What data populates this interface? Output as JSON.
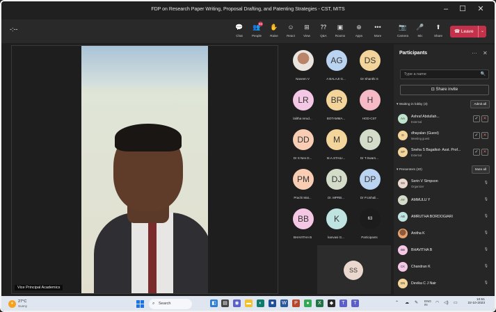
{
  "window": {
    "title": "FDP on Research Paper Writing, Proposal Drafting, and Patenting Strategies - CST, MITS",
    "minimize": "–",
    "maximize": "☐",
    "close": "✕"
  },
  "toolbar": {
    "timer": "-:--",
    "buttons": [
      {
        "label": "Chat",
        "icon": "chat-icon",
        "glyph": "💬"
      },
      {
        "label": "People",
        "icon": "people-icon",
        "glyph": "👥",
        "badge": "83"
      },
      {
        "label": "Raise",
        "icon": "raise-hand-icon",
        "glyph": "✋"
      },
      {
        "label": "React",
        "icon": "react-icon",
        "glyph": "☺"
      },
      {
        "label": "View",
        "icon": "view-icon",
        "glyph": "⊞"
      },
      {
        "label": "Q&A",
        "icon": "qa-icon",
        "glyph": "⁇"
      },
      {
        "label": "Rooms",
        "icon": "rooms-icon",
        "glyph": "▣"
      },
      {
        "label": "Apps",
        "icon": "apps-icon",
        "glyph": "⊕"
      },
      {
        "label": "More",
        "icon": "more-icon",
        "glyph": "•••"
      },
      {
        "label": "Camera",
        "icon": "camera-off-icon",
        "glyph": "📷"
      },
      {
        "label": "Mic",
        "icon": "mic-off-icon",
        "glyph": "🎤"
      },
      {
        "label": "Share",
        "icon": "share-icon",
        "glyph": "⬆"
      }
    ],
    "leave_label": "Leave",
    "leave_chevron": "⌄"
  },
  "main_video": {
    "caption": "Vice Principal Academics"
  },
  "tiles": [
    {
      "name": "Naveen V",
      "initials": "",
      "color": "#e8e0d8",
      "photo": true
    },
    {
      "name": "A BALAJI G...",
      "initials": "AG",
      "color": "#b9d3f0"
    },
    {
      "name": "Dr Shanthi S",
      "initials": "DS",
      "color": "#f3d49a"
    },
    {
      "name": "lalitha rerud...",
      "initials": "LR",
      "color": "#f4c8e4"
    },
    {
      "name": "BOTAMMA...",
      "initials": "BR",
      "color": "#f3d49a"
    },
    {
      "name": "HOD-CST",
      "initials": "H",
      "color": "#f6b9c6"
    },
    {
      "name": "Dr S Nes D...",
      "initials": "DD",
      "color": "#f8cdb4"
    },
    {
      "name": "M.A.STAILI...",
      "initials": "M",
      "color": "#f3d49a"
    },
    {
      "name": "Dr T.Swarn...",
      "initials": "D",
      "color": "#d3dcc9"
    },
    {
      "name": "Prachi Mat...",
      "initials": "PM",
      "color": "#f8cdb4"
    },
    {
      "name": "Dr. MPRB...",
      "initials": "DJ",
      "color": "#d3dcc9"
    },
    {
      "name": "Dr P.Ushali...",
      "initials": "DP",
      "color": "#b9d3f0"
    },
    {
      "name": "BHAVITHA B",
      "initials": "BB",
      "color": "#f4c8e4"
    },
    {
      "name": "kanvasi G...",
      "initials": "K",
      "color": "#bfe3e0"
    },
    {
      "name": "Participants",
      "initials": "63",
      "color": "#1c1c1c"
    }
  ],
  "self_tile": {
    "initials": "SS"
  },
  "participants": {
    "title": "Participants",
    "search_placeholder": "Type a name",
    "share_invite": "Share invite",
    "lobby_header": "Waiting in lobby (3)",
    "admit_all": "Admit all",
    "lobby": [
      {
        "initials": "AA",
        "name": "Ashraf Abdullah...",
        "status": "External",
        "color": "#bfe3cd"
      },
      {
        "initials": "D",
        "name": "dhayalan (Guest)",
        "status": "Meeting guest",
        "color": "#f3d49a"
      },
      {
        "initials": "SP",
        "name": "Sneha S Bagalkot- Asst. Prof...",
        "status": "External",
        "color": "#f3d49a"
      }
    ],
    "presenters_header": "Presenters (20)",
    "mute_all": "Mute all",
    "presenters": [
      {
        "initials": "SS",
        "name": "Serin V Simpson",
        "status": "Organizer",
        "color": "#ead7cd"
      },
      {
        "initials": "AY",
        "name": "AMMULU Y",
        "status": "",
        "color": "#d3dcc9"
      },
      {
        "initials": "AB",
        "name": "AMRUTHA BORDOGIARI",
        "status": "",
        "color": "#bfe3e0"
      },
      {
        "initials": "AK",
        "name": "Anitha K",
        "status": "",
        "color": "#e8a06c",
        "photo": true
      },
      {
        "initials": "BB",
        "name": "BHAVITHA B",
        "status": "",
        "color": "#f4c8e4"
      },
      {
        "initials": "CK",
        "name": "Chandran K",
        "status": "",
        "color": "#f4c8e4"
      },
      {
        "initials": "DN",
        "name": "Devika C J Nair",
        "status": "",
        "color": "#f3d49a"
      }
    ]
  },
  "taskbar": {
    "temp": "27°C",
    "condition": "Sunny",
    "search": "Search",
    "lang": "ENG",
    "lang2": "IN",
    "time": "10:51",
    "date": "22-10-2023"
  }
}
